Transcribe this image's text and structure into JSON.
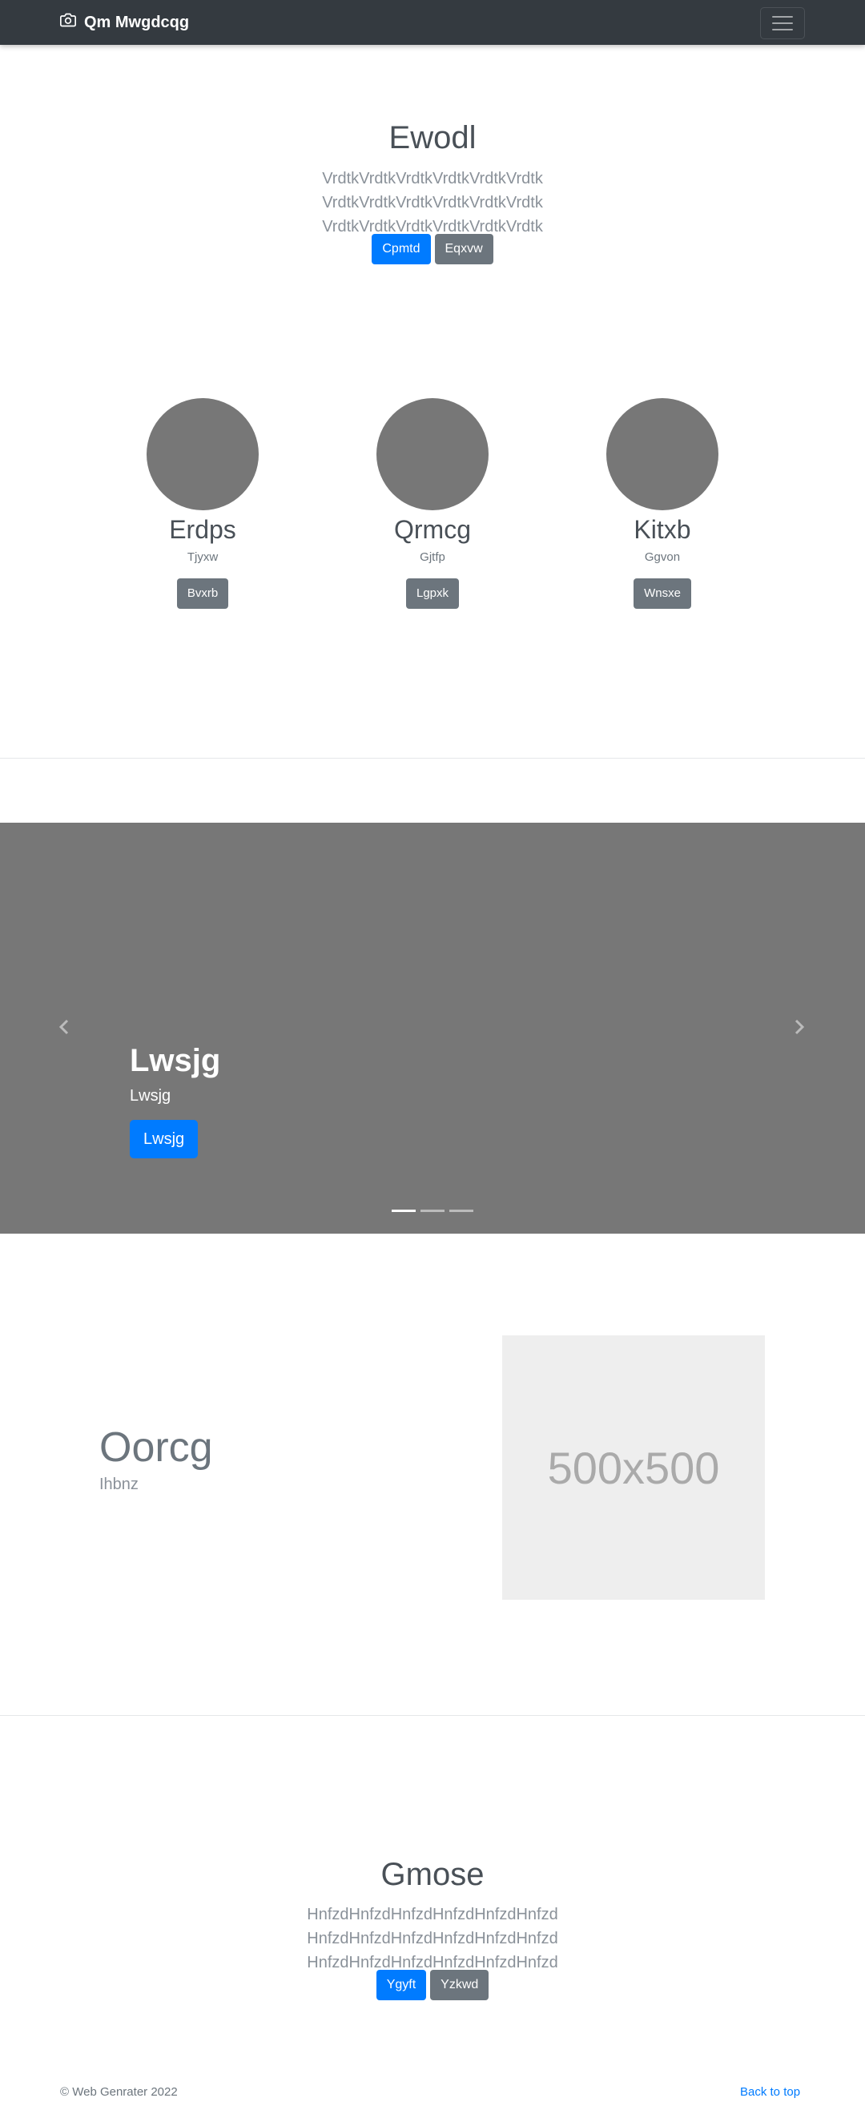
{
  "navbar": {
    "brand": "Qm Mwgdcqg",
    "brand_icon": "camera-icon",
    "toggler_icon": "hamburger-icon"
  },
  "hero": {
    "title": "Ewodl",
    "lead": "VrdtkVrdtkVrdtkVrdtkVrdtkVrdtk VrdtkVrdtkVrdtkVrdtkVrdtkVrdtk VrdtkVrdtkVrdtkVrdtkVrdtkVrdtk",
    "primary": "Cpmtd",
    "secondary": "Eqxvw"
  },
  "features": [
    {
      "title": "Erdps",
      "subtitle": "Tjyxw",
      "button": "Bvxrb"
    },
    {
      "title": "Qrmcg",
      "subtitle": "Gjtfp",
      "button": "Lgpxk"
    },
    {
      "title": "Kitxb",
      "subtitle": "Ggvon",
      "button": "Wnsxe"
    }
  ],
  "carousel": {
    "title": "Lwsjg",
    "text": "Lwsjg",
    "button": "Lwsjg",
    "slides": 3,
    "active": 1,
    "background": "#777777"
  },
  "featurette": {
    "title": "Oorcg",
    "subtitle": "Ihbnz",
    "image_label": "500x500"
  },
  "hero2": {
    "title": "Gmose",
    "lead": "HnfzdHnfzdHnfzdHnfzdHnfzdHnfzd HnfzdHnfzdHnfzdHnfzdHnfzdHnfzd HnfzdHnfzdHnfzdHnfzdHnfzdHnfzd",
    "primary": "Ygyft",
    "secondary": "Yzkwd"
  },
  "footer": {
    "copyright": "© Web Genrater 2022",
    "back_to_top": "Back to top"
  },
  "colors": {
    "primary": "#007bff",
    "secondary": "#6c757d",
    "navbar": "#343a40"
  }
}
